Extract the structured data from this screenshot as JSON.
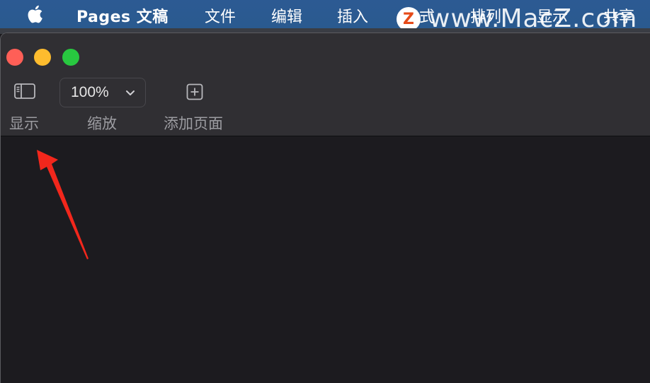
{
  "menubar": {
    "app_name": "Pages 文稿",
    "items": [
      "文件",
      "编辑",
      "插入",
      "格式",
      "排列",
      "显示",
      "共享"
    ]
  },
  "watermark": {
    "logo_letter": "Z",
    "text": "www.MacZ.com"
  },
  "window": {
    "traffic_lights": {
      "close_color": "#ff5f57",
      "minimize_color": "#febc2e",
      "zoom_color": "#28c840"
    },
    "toolbar": {
      "show_label": "显示",
      "zoom_value": "100%",
      "zoom_label": "缩放",
      "add_page_label": "添加页面"
    }
  },
  "icons": {
    "apple": "apple-icon",
    "sidebar": "sidebar-toggle-icon",
    "zoom_chevron": "chevron-down-icon",
    "add_page": "plus-square-icon"
  },
  "annotation": {
    "arrow_color": "#f2271c"
  }
}
